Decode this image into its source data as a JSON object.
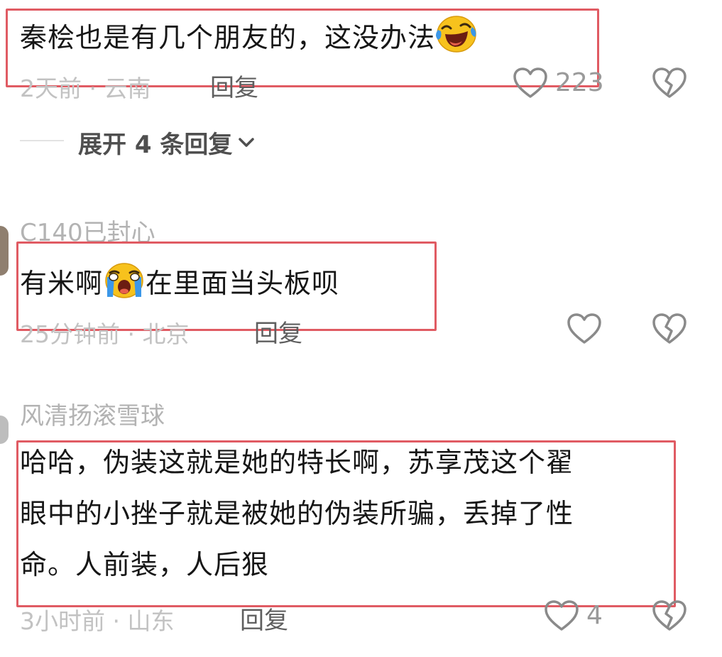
{
  "comments": [
    {
      "username": "",
      "text": "秦桧也是有几个朋友的，这没办法",
      "emoji": "laughing-tears-emoji",
      "time": "2天前 · 云南",
      "reply": "回复",
      "likes": "223"
    },
    {
      "username": "C140已封心",
      "text_before": "有米啊",
      "emoji": "crying-emoji",
      "text_after": "在里面当头板呗",
      "time": "25分钟前 · 北京",
      "reply": "回复",
      "likes": ""
    },
    {
      "username": "风清扬滚雪球",
      "lines": [
        "哈哈，伪装这就是她的特长啊，苏享茂这个翟",
        "眼中的小挫子就是被她的伪装所骗，丢掉了性",
        "命。人前装，人后狠"
      ],
      "time": "3小时前 · 山东",
      "reply": "回复",
      "likes": "4"
    }
  ],
  "expand_replies": {
    "label": "展开 4 条回复"
  },
  "icons": {
    "like": "heart-outline-icon",
    "dislike": "broken-heart-icon",
    "expand": "chevron-down-icon"
  },
  "colors": {
    "highlight_border": "#e05b63",
    "icon_stroke": "#8a8a8a",
    "emoji_face": "#f7c21d",
    "emoji_tears": "#3b97e8"
  }
}
